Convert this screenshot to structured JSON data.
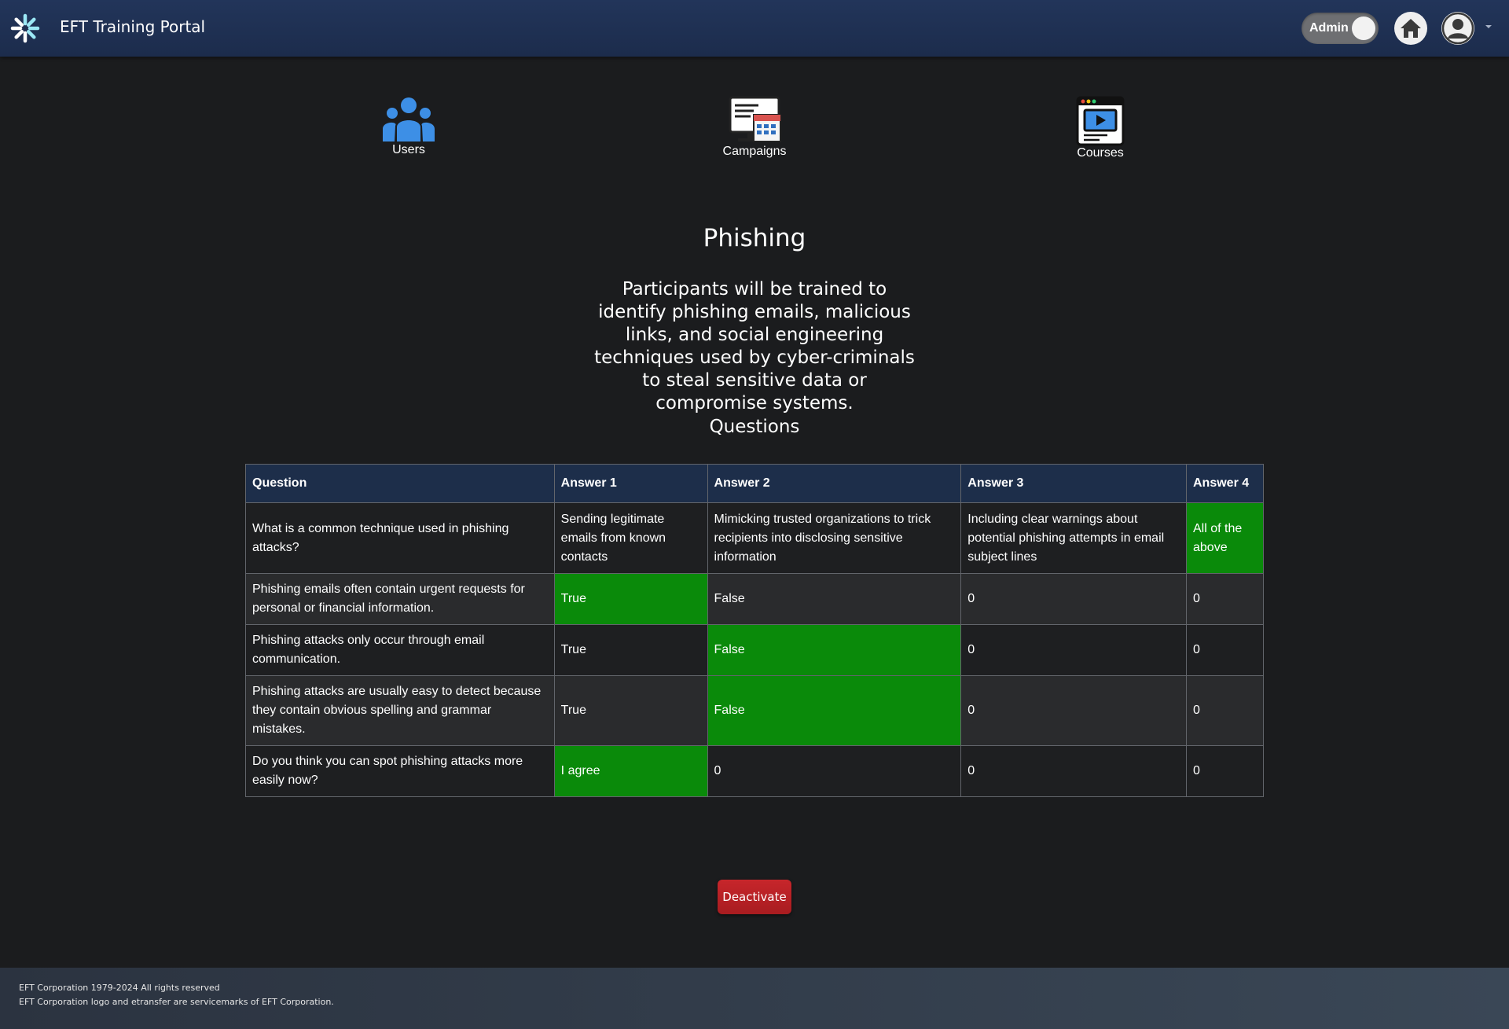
{
  "header": {
    "app_title": "EFT Training Portal",
    "admin_toggle_label": "Admin",
    "admin_toggle_on": true,
    "icons": [
      "asterisk-logo-icon",
      "home-icon",
      "user-avatar-icon",
      "chevron-down-icon"
    ]
  },
  "nav": {
    "users": {
      "label": "Users",
      "icon": "users-group-icon",
      "color": "#3d8fe6"
    },
    "campaigns": {
      "label": "Campaigns",
      "icon": "monitor-calendar-icon"
    },
    "courses": {
      "label": "Courses",
      "icon": "video-play-icon"
    }
  },
  "course": {
    "title": "Phishing",
    "description": "Participants will be trained to identify phishing emails, malicious links, and social engineering techniques used by cyber-criminals to steal sensitive data or compromise systems.",
    "questions_heading": "Questions"
  },
  "table": {
    "headers": [
      "Question",
      "Answer 1",
      "Answer 2",
      "Answer 3",
      "Answer 4"
    ],
    "rows": [
      {
        "question": "What is a common technique used in phishing attacks?",
        "answers": [
          "Sending legitimate emails from known contacts",
          "Mimicking trusted organizations to trick recipients into disclosing sensitive information",
          "Including clear warnings about potential phishing attempts in email subject lines",
          "All of the above"
        ],
        "correct_index": 3
      },
      {
        "question": "Phishing emails often contain urgent requests for personal or financial information.",
        "answers": [
          "True",
          "False",
          "0",
          "0"
        ],
        "correct_index": 0
      },
      {
        "question": "Phishing attacks only occur through email communication.",
        "answers": [
          "True",
          "False",
          "0",
          "0"
        ],
        "correct_index": 1
      },
      {
        "question": "Phishing attacks are usually easy to detect because they contain obvious spelling and grammar mistakes.",
        "answers": [
          "True",
          "False",
          "0",
          "0"
        ],
        "correct_index": 1
      },
      {
        "question": "Do you think you can spot phishing attacks more easily now?",
        "answers": [
          "I agree",
          "0",
          "0",
          "0"
        ],
        "correct_index": 0
      }
    ],
    "correct_color": "#0a8a0a"
  },
  "actions": {
    "deactivate_label": "Deactivate",
    "deactivate_color": "#c7262b"
  },
  "footer": {
    "line1": "EFT Corporation 1979-2024 All rights reserved",
    "line2": "EFT Corporation logo and etransfer are servicemarks of EFT Corporation."
  }
}
